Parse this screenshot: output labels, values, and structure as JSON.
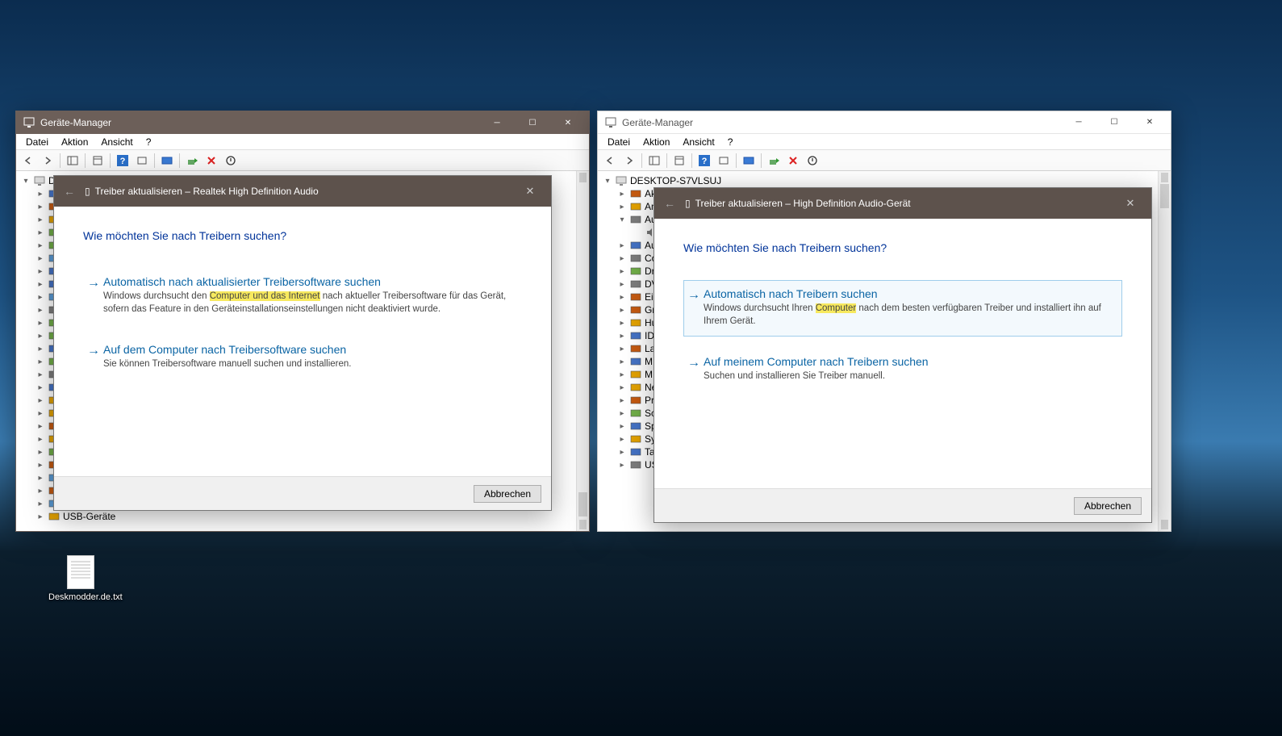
{
  "desktop": {
    "file_label": "Deskmodder.de.txt"
  },
  "menus": {
    "datei": "Datei",
    "aktion": "Aktion",
    "ansicht": "Ansicht",
    "help": "?"
  },
  "win_left": {
    "title": "Geräte-Manager",
    "tree": {
      "root": "D",
      "nodes": [
        "",
        "",
        "",
        "",
        "",
        "",
        "",
        "",
        "",
        "",
        "",
        "",
        "",
        "",
        "",
        "",
        "",
        "",
        "",
        "",
        "",
        "",
        "",
        "",
        "",
        "USB-Geräte"
      ]
    }
  },
  "win_right": {
    "title": "Geräte-Manager",
    "tree": {
      "root": "DESKTOP-S7VLSUJ",
      "nodes": [
        "Ak",
        "An",
        "Au",
        "Au",
        "Co",
        "Dr",
        "DV",
        "Ei",
        "Gr",
        "Hu",
        "ID",
        "La",
        "M",
        "M",
        "Ne",
        "Pr",
        "Sc",
        "Sp",
        "Sy",
        "Ta",
        "US"
      ]
    }
  },
  "dlg_left": {
    "title": "Treiber aktualisieren – Realtek High Definition Audio",
    "heading": "Wie möchten Sie nach Treibern suchen?",
    "opt1_title": "Automatisch nach aktualisierter Treibersoftware suchen",
    "opt1_desc_a": "Windows durchsucht den ",
    "opt1_desc_hl": "Computer und das Internet",
    "opt1_desc_b": " nach aktueller Treibersoftware für das Gerät, sofern das Feature in den Geräteinstallationseinstellungen nicht deaktiviert wurde.",
    "opt2_title": "Auf dem Computer nach Treibersoftware suchen",
    "opt2_desc": "Sie können Treibersoftware manuell suchen und installieren.",
    "cancel": "Abbrechen"
  },
  "dlg_right": {
    "title": "Treiber aktualisieren – High Definition Audio-Gerät",
    "heading": "Wie möchten Sie nach Treibern suchen?",
    "opt1_title": "Automatisch nach Treibern suchen",
    "opt1_desc_a": "Windows durchsucht Ihren ",
    "opt1_desc_hl": "Computer",
    "opt1_desc_b": " nach dem besten verfügbaren Treiber und installiert ihn auf Ihrem Gerät.",
    "opt2_title": "Auf meinem Computer nach Treibern suchen",
    "opt2_desc": "Suchen und installieren Sie Treiber manuell.",
    "cancel": "Abbrechen"
  }
}
